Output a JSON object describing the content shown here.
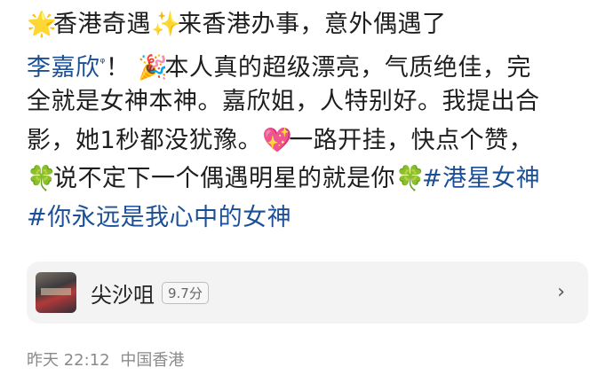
{
  "post": {
    "lines": [
      [
        "香港奇遇",
        "来香港办事，意外偶遇了"
      ],
      [
        "李嘉欣",
        "！ ",
        "本人真的超级漂亮，气质绝佳，完"
      ],
      [
        "全就是女神本神。嘉欣姐，人特别好。我提出合"
      ],
      [
        "影，她1秒都没犹豫。",
        "一路开挂，快点个赞，"
      ],
      [
        "说不定下一个偶遇明星的就是你",
        "#港星女神"
      ],
      [
        "#你永远是我心中的女神"
      ]
    ],
    "icons": {
      "star": "🌟",
      "sparkles": "✨",
      "party": "🎉",
      "heart": "💖",
      "clover": "🍀",
      "mention_marker": "ᵠ"
    }
  },
  "location": {
    "name": "尖沙咀",
    "rating": "9.7分",
    "chevron": "›"
  },
  "meta": {
    "time": "昨天 22:12",
    "region": "中国香港"
  }
}
